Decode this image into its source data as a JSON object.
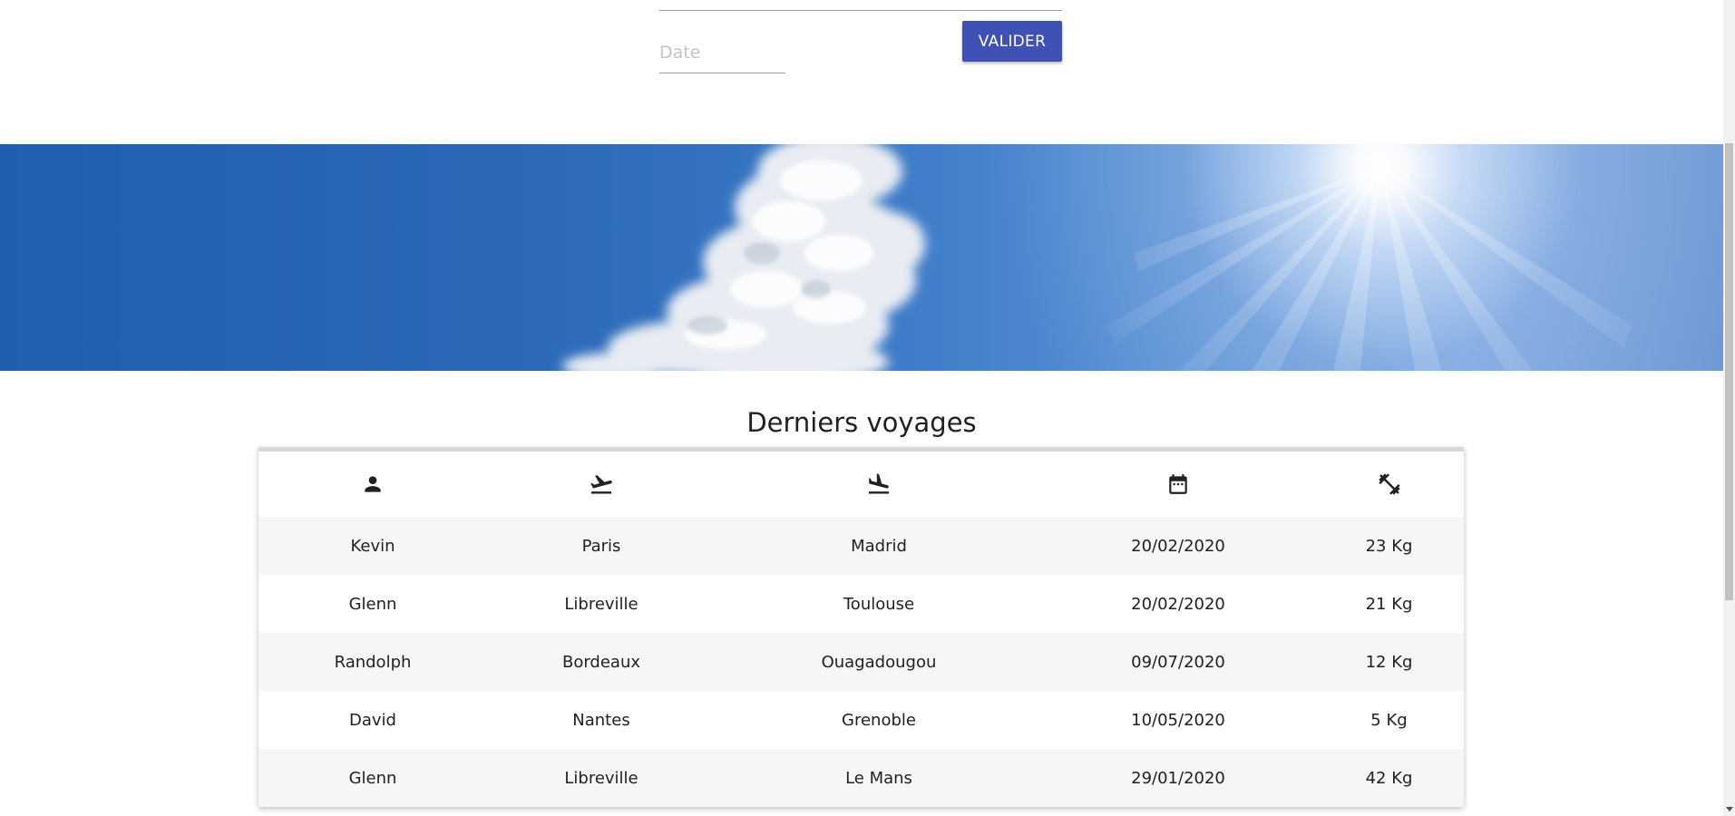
{
  "form": {
    "date_placeholder": "Date",
    "submit_label": "VALIDER"
  },
  "colors": {
    "primary": "#3f51b5",
    "row_stripe": "#f6f6f6",
    "sky": "#2b69b7"
  },
  "trips": {
    "title": "Derniers voyages",
    "columns": [
      {
        "icon": "person-icon"
      },
      {
        "icon": "flight-takeoff-icon"
      },
      {
        "icon": "flight-land-icon"
      },
      {
        "icon": "calendar-icon"
      },
      {
        "icon": "weight-icon"
      }
    ],
    "rows": [
      {
        "name": "Kevin",
        "from": "Paris",
        "to": "Madrid",
        "date": "20/02/2020",
        "weight": "23 Kg"
      },
      {
        "name": "Glenn",
        "from": "Libreville",
        "to": "Toulouse",
        "date": "20/02/2020",
        "weight": "21 Kg"
      },
      {
        "name": "Randolph",
        "from": "Bordeaux",
        "to": "Ouagadougou",
        "date": "09/07/2020",
        "weight": "12 Kg"
      },
      {
        "name": "David",
        "from": "Nantes",
        "to": "Grenoble",
        "date": "10/05/2020",
        "weight": "5 Kg"
      },
      {
        "name": "Glenn",
        "from": "Libreville",
        "to": "Le Mans",
        "date": "29/01/2020",
        "weight": "42 Kg"
      }
    ]
  }
}
